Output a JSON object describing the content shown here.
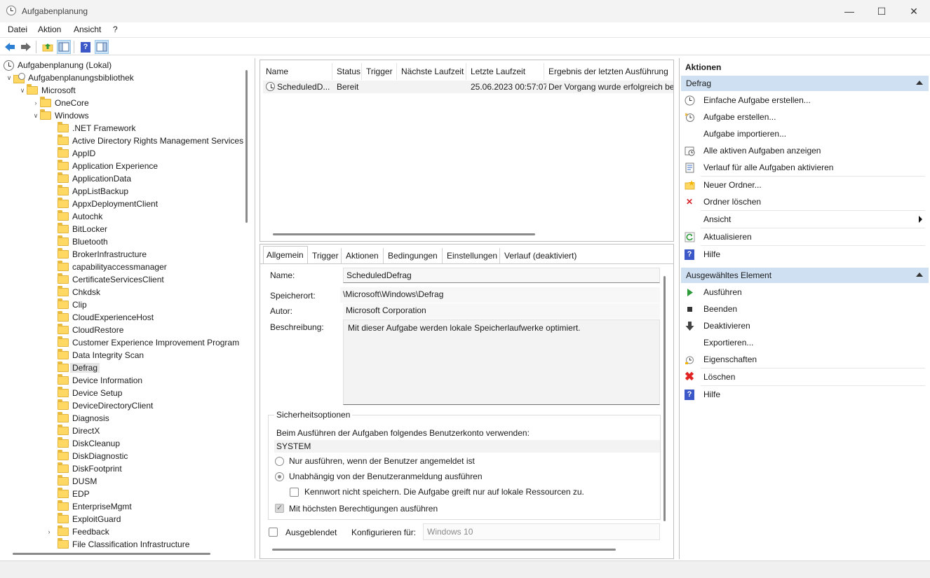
{
  "window": {
    "title": "Aufgabenplanung"
  },
  "menu": [
    "Datei",
    "Aktion",
    "Ansicht",
    "?"
  ],
  "tree": {
    "root": "Aufgabenplanung (Lokal)",
    "library": "Aufgabenplanungsbibliothek",
    "microsoft": "Microsoft",
    "onecore": "OneCore",
    "windows": "Windows",
    "folders": [
      ".NET Framework",
      "Active Directory Rights Management Services",
      "AppID",
      "Application Experience",
      "ApplicationData",
      "AppListBackup",
      "AppxDeploymentClient",
      "Autochk",
      "BitLocker",
      "Bluetooth",
      "BrokerInfrastructure",
      "capabilityaccessmanager",
      "CertificateServicesClient",
      "Chkdsk",
      "Clip",
      "CloudExperienceHost",
      "CloudRestore",
      "Customer Experience Improvement Program",
      "Data Integrity Scan",
      "Defrag",
      "Device Information",
      "Device Setup",
      "DeviceDirectoryClient",
      "Diagnosis",
      "DirectX",
      "DiskCleanup",
      "DiskDiagnostic",
      "DiskFootprint",
      "DUSM",
      "EDP",
      "EnterpriseMgmt",
      "ExploitGuard",
      "Feedback",
      "File Classification Infrastructure"
    ],
    "selected": "Defrag"
  },
  "task_list": {
    "columns": [
      "Name",
      "Status",
      "Trigger",
      "Nächste Laufzeit",
      "Letzte Laufzeit",
      "Ergebnis der letzten Ausführung"
    ],
    "row": {
      "name": "ScheduledD...",
      "status": "Bereit",
      "trigger": "",
      "next_run": "",
      "last_run": "25.06.2023 00:57:07",
      "result": "Der Vorgang wurde erfolgreich be"
    }
  },
  "details": {
    "tabs": [
      "Allgemein",
      "Trigger",
      "Aktionen",
      "Bedingungen",
      "Einstellungen",
      "Verlauf (deaktiviert)"
    ],
    "name_label": "Name:",
    "name_value": "ScheduledDefrag",
    "location_label": "Speicherort:",
    "location_value": "\\Microsoft\\Windows\\Defrag",
    "author_label": "Autor:",
    "author_value": "Microsoft Corporation",
    "description_label": "Beschreibung:",
    "description_value": "Mit dieser Aufgabe werden lokale Speicherlaufwerke optimiert.",
    "security_title": "Sicherheitsoptionen",
    "account_prompt": "Beim Ausführen der Aufgaben folgendes Benutzerkonto verwenden:",
    "account_value": "SYSTEM",
    "opt_logged_on": "Nur ausführen, wenn der Benutzer angemeldet ist",
    "opt_independent": "Unabhängig von der Benutzeranmeldung ausführen",
    "opt_no_password": "Kennwort nicht speichern. Die Aufgabe greift nur auf lokale Ressourcen zu.",
    "opt_highest": "Mit höchsten Berechtigungen ausführen",
    "hidden_label": "Ausgeblendet",
    "configure_label": "Konfigurieren für:",
    "configure_value": "Windows 10"
  },
  "actions": {
    "title": "Aktionen",
    "section1": "Defrag",
    "section1_items": [
      {
        "label": "Einfache Aufgabe erstellen...",
        "icon": "basic-task-icon"
      },
      {
        "label": "Aufgabe erstellen...",
        "icon": "create-task-icon"
      },
      {
        "label": "Aufgabe importieren...",
        "icon": ""
      },
      {
        "label": "Alle aktiven Aufgaben anzeigen",
        "icon": "active-tasks-icon"
      },
      {
        "label": "Verlauf für alle Aufgaben aktivieren",
        "icon": "history-icon"
      },
      {
        "label": "Neuer Ordner...",
        "icon": "new-folder-icon"
      },
      {
        "label": "Ordner löschen",
        "icon": "delete-folder-icon"
      },
      {
        "label": "Ansicht",
        "icon": ""
      },
      {
        "label": "Aktualisieren",
        "icon": "refresh-icon"
      },
      {
        "label": "Hilfe",
        "icon": "help-icon"
      }
    ],
    "section2": "Ausgewähltes Element",
    "section2_items": [
      {
        "label": "Ausführen",
        "icon": "run-icon"
      },
      {
        "label": "Beenden",
        "icon": "stop-icon"
      },
      {
        "label": "Deaktivieren",
        "icon": "disable-icon"
      },
      {
        "label": "Exportieren...",
        "icon": ""
      },
      {
        "label": "Eigenschaften",
        "icon": "properties-icon"
      },
      {
        "label": "Löschen",
        "icon": "delete-icon"
      },
      {
        "label": "Hilfe",
        "icon": "help-icon"
      }
    ]
  },
  "colors": {
    "section_header": "#cfe0f3",
    "selection": "#e5e5e5",
    "accent": "#3b57c8"
  }
}
